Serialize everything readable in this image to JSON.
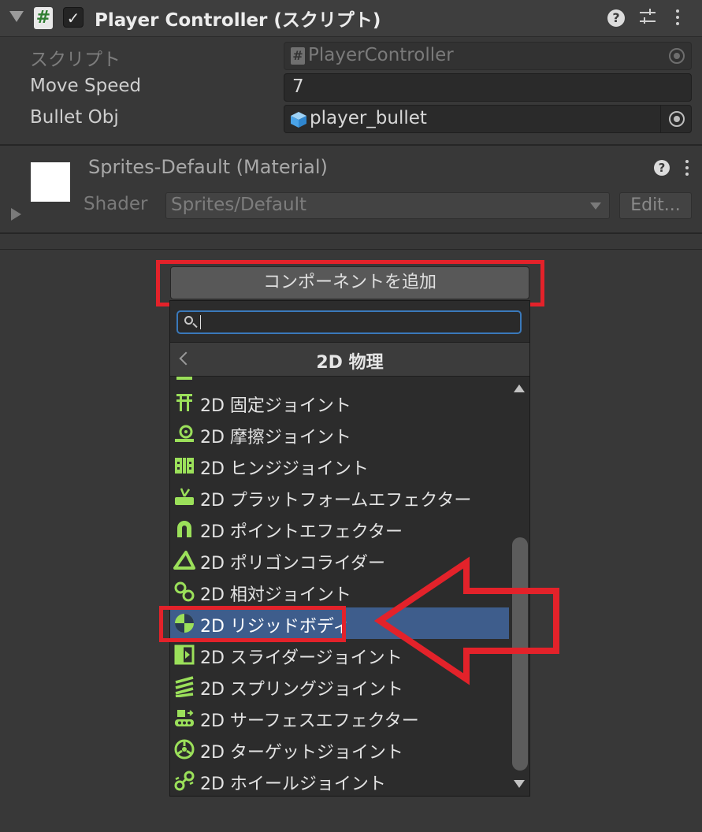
{
  "component": {
    "title": "Player Controller (スクリプト)",
    "enabled": true
  },
  "properties": {
    "script_label": "スクリプト",
    "script_value": "PlayerController",
    "move_speed_label": "Move Speed",
    "move_speed_value": "7",
    "bullet_obj_label": "Bullet Obj",
    "bullet_obj_value": "player_bullet"
  },
  "material": {
    "title": "Sprites-Default (Material)",
    "shader_label": "Shader",
    "shader_value": "Sprites/Default",
    "edit_label": "Edit..."
  },
  "add_component": {
    "button_label": "コンポーネントを追加",
    "search_value": "",
    "category": "2D 物理",
    "items": [
      {
        "label": "2D 固定ジョイント",
        "icon": "fixed-joint-icon"
      },
      {
        "label": "2D 摩擦ジョイント",
        "icon": "friction-joint-icon"
      },
      {
        "label": "2D ヒンジジョイント",
        "icon": "hinge-joint-icon"
      },
      {
        "label": "2D プラットフォームエフェクター",
        "icon": "platform-effector-icon"
      },
      {
        "label": "2D ポイントエフェクター",
        "icon": "point-effector-icon"
      },
      {
        "label": "2D ポリゴンコライダー",
        "icon": "polygon-collider-icon"
      },
      {
        "label": "2D 相対ジョイント",
        "icon": "relative-joint-icon"
      },
      {
        "label": "2D リジッドボディ",
        "icon": "rigidbody-icon",
        "selected": true
      },
      {
        "label": "2D スライダージョイント",
        "icon": "slider-joint-icon"
      },
      {
        "label": "2D スプリングジョイント",
        "icon": "spring-joint-icon"
      },
      {
        "label": "2D サーフェスエフェクター",
        "icon": "surface-effector-icon"
      },
      {
        "label": "2D ターゲットジョイント",
        "icon": "target-joint-icon"
      },
      {
        "label": "2D ホイールジョイント",
        "icon": "wheel-joint-icon"
      }
    ]
  },
  "colors": {
    "highlight_red": "#e3222a",
    "selection_blue": "#3e5d8c",
    "icon_green": "#9be05a"
  }
}
